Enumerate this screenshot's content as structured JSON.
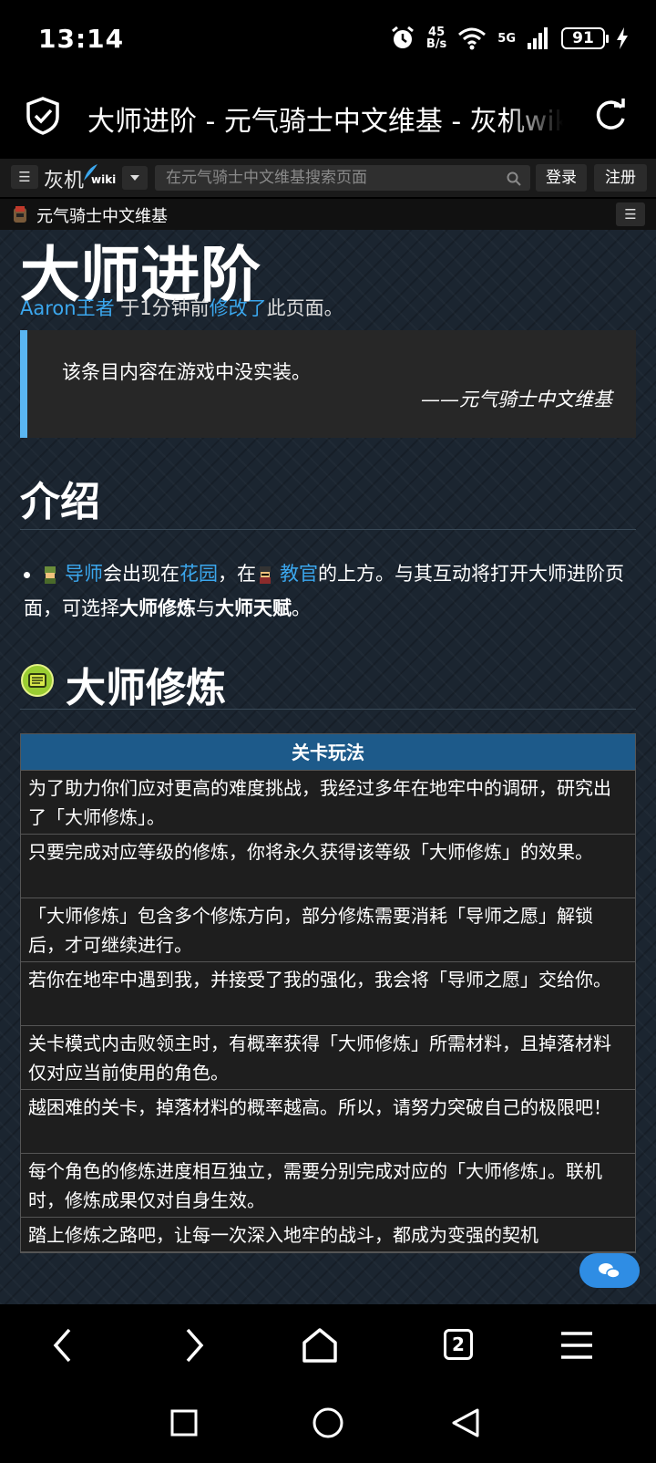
{
  "status": {
    "time": "13:14",
    "net_speed_top": "45",
    "net_speed_bottom": "B/s",
    "network": "5G",
    "battery": "91"
  },
  "browser": {
    "title": "大师进阶 - 元气骑士中文维基 - 灰机wiki",
    "tab_count": "2"
  },
  "wiki_bar": {
    "logo": "灰机",
    "logo_suffix": "wiki",
    "search_placeholder": "在元气骑士中文维基搜索页面",
    "login": "登录",
    "register": "注册"
  },
  "site": {
    "name": "元气骑士中文维基"
  },
  "article": {
    "title": "大师进阶",
    "editor": "Aaron王者",
    "edit_time": " 于1分钟前",
    "edit_link": "修改了",
    "edit_suffix": "此页面。",
    "quote": "该条目内容在游戏中没实装。",
    "quote_source": "——元气骑士中文维基",
    "section_intro": "介绍",
    "intro": {
      "mentor": "导师",
      "t1": "会出现在",
      "garden": "花园",
      "t2": "，在",
      "officer": "教官",
      "t3": "的上方。与其互动将打开大师进阶页面，可选择",
      "b1": "大师修炼",
      "t4": "与",
      "b2": "大师天赋",
      "t5": "。"
    },
    "section_training": "大师修炼",
    "table_header": "关卡玩法",
    "table_rows": [
      "为了助力你们应对更高的难度挑战，我经过多年在地牢中的调研，研究出了「大师修炼」。",
      "只要完成对应等级的修炼，你将永久获得该等级「大师修炼」的效果。",
      "「大师修炼」包含多个修炼方向，部分修炼需要消耗「导师之愿」解锁后，才可继续进行。",
      "若你在地牢中遇到我，并接受了我的强化，我会将「导师之愿」交给你。",
      "关卡模式内击败领主时，有概率获得「大师修炼」所需材料，且掉落材料仅对应当前使用的角色。",
      "越困难的关卡，掉落材料的概率越高。所以，请努力突破自己的极限吧！",
      "每个角色的修炼进度相互独立，需要分别完成对应的「大师修炼」。联机时，修炼成果仅对自身生效。",
      "踏上修炼之路吧，让每一次深入地牢的战斗，都成为变强的契机"
    ]
  }
}
